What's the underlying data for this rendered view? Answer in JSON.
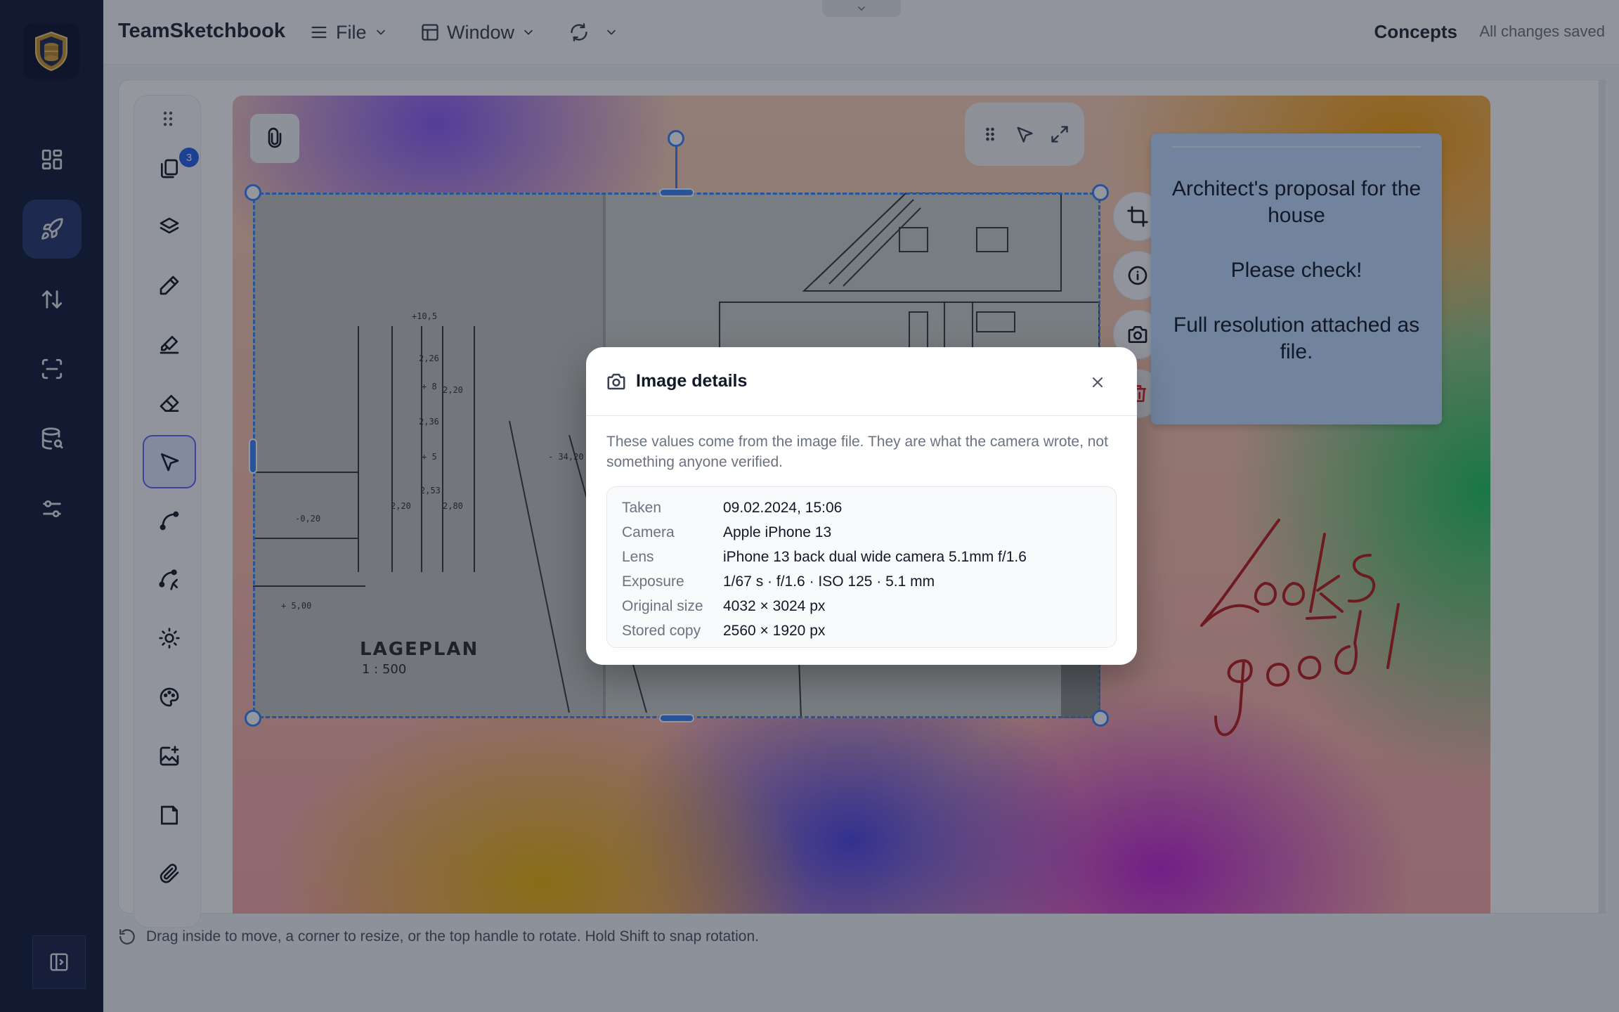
{
  "app": {
    "title": "TeamSketchbook",
    "menu_file": "File",
    "menu_window": "Window",
    "project_name": "Concepts",
    "save_status": "All changes saved"
  },
  "nav": {
    "items": [
      {
        "icon": "dashboard-icon"
      },
      {
        "icon": "rocket-icon",
        "active": true
      },
      {
        "icon": "sort-arrows-icon"
      },
      {
        "icon": "scan-icon"
      },
      {
        "icon": "database-search-icon"
      },
      {
        "icon": "sliders-icon"
      }
    ]
  },
  "tools": {
    "pages_count": "3"
  },
  "sticky_note": {
    "line1": "Architect's proposal for the house",
    "line2": "Please check!",
    "line3": "Full resolution attached as file."
  },
  "modal": {
    "title": "Image details",
    "description": "These values come from the image file. They are what the camera wrote, not something anyone verified.",
    "rows": [
      {
        "label": "Taken",
        "value": "09.02.2024, 15:06"
      },
      {
        "label": "Camera",
        "value": "Apple iPhone 13"
      },
      {
        "label": "Lens",
        "value": "iPhone 13 back dual wide camera 5.1mm f/1.6"
      },
      {
        "label": "Exposure",
        "value": "1/67 s · f/1.6 · ISO 125 · 5.1 mm"
      },
      {
        "label": "Original size",
        "value": "4032 × 3024 px"
      },
      {
        "label": "Stored copy",
        "value": "2560 × 1920 px"
      }
    ]
  },
  "footer": {
    "hint": "Drag inside to move, a corner to resize, or the top handle to rotate. Hold Shift to snap rotation."
  },
  "colors": {
    "nav_bg": "#131c3b",
    "nav_active": "#27386f",
    "selection": "#3b82f6",
    "sticky": "#bfdbfe",
    "ink": "#b91c1c"
  }
}
